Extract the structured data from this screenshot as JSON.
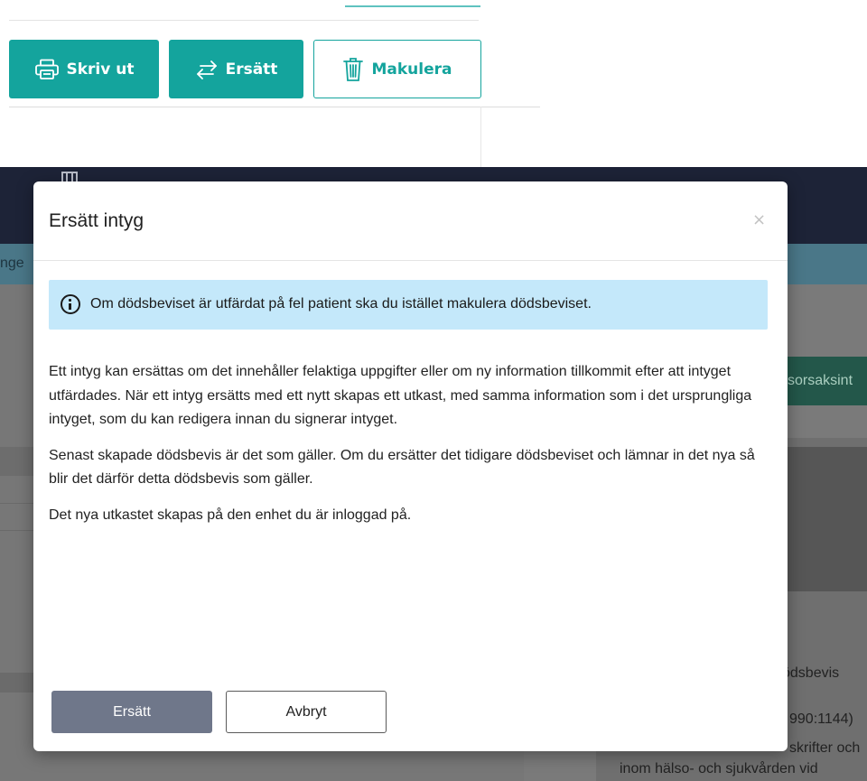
{
  "toolbar": {
    "print_label": "Skriv ut",
    "replace_label": "Ersätt",
    "discard_label": "Makulera",
    "accent_color": "#14a49d"
  },
  "background": {
    "strip_text": "nge",
    "green_button_text": "sorsaksint",
    "right_text_1": "ödsbevis",
    "right_text_2": "990:1144)",
    "right_text_3": "skrifter och",
    "right_text_4": "inom hälso- och sjukvården vid"
  },
  "modal": {
    "title": "Ersätt intyg",
    "close_symbol": "×",
    "info_text": "Om dödsbeviset är utfärdat på fel patient ska du istället makulera dödsbeviset.",
    "paragraphs": [
      "Ett intyg kan ersättas om det innehåller felaktiga uppgifter eller om ny information tillkommit efter att intyget utfärdades. När ett intyg ersätts med ett nytt skapas ett utkast, med samma information som i det ursprungliga intyget, som du kan redigera innan du signerar intyget.",
      "Senast skapade dödsbevis är det som gäller. Om du ersätter det tidigare dödsbeviset och lämnar in det nya så blir det därför detta dödsbevis som gäller.",
      "Det nya utkastet skapas på den enhet du är inloggad på."
    ],
    "confirm_label": "Ersätt",
    "cancel_label": "Avbryt",
    "info_bg_color": "#c4e8fa",
    "confirm_color": "#6f778a"
  }
}
